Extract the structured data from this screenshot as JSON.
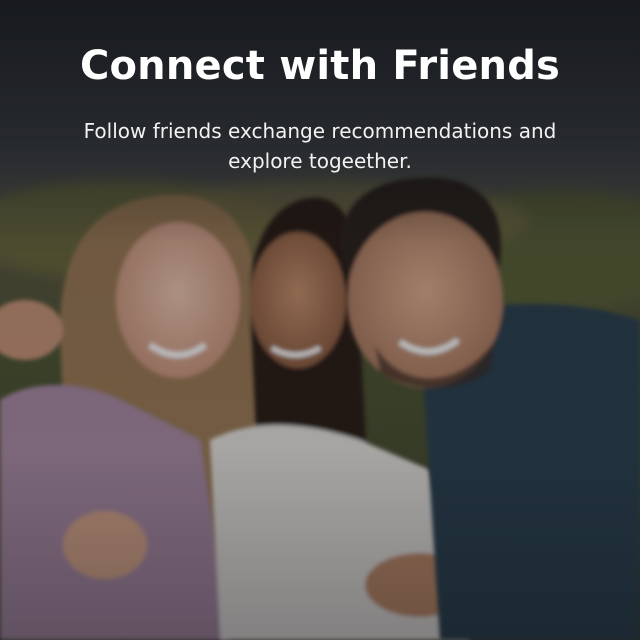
{
  "onboarding": {
    "title": "Connect with Friends",
    "description": "Follow friends exchange recommendations and explore togeether.",
    "background_image": "three-friends-selfie-photo"
  },
  "colors": {
    "title_text": "#ffffff",
    "body_text": "#f2f2f2"
  }
}
